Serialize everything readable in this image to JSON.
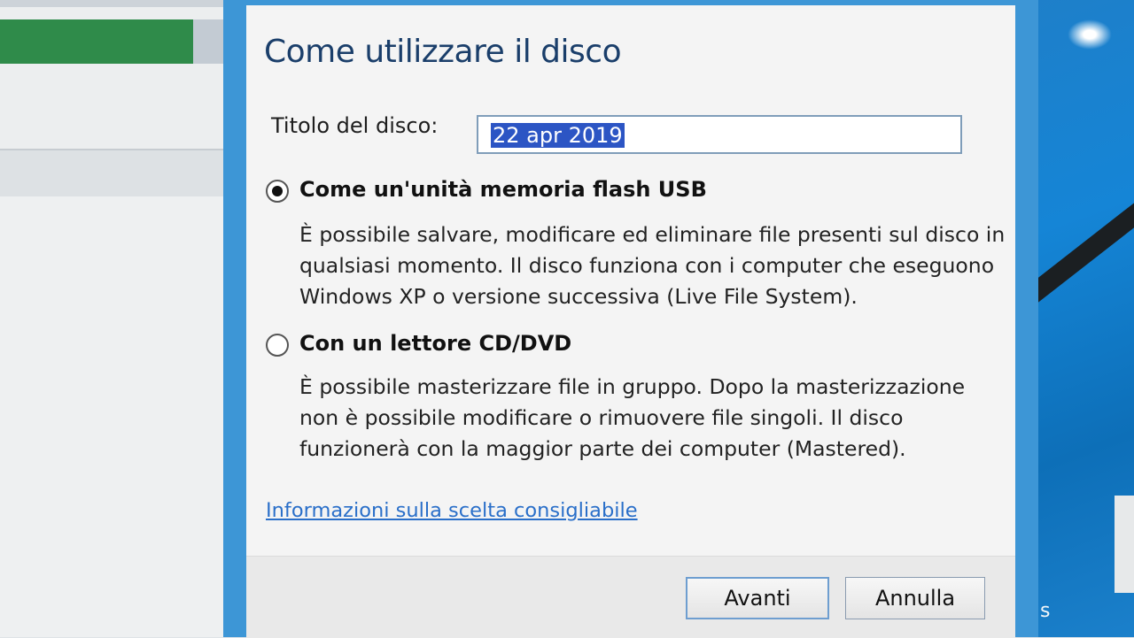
{
  "dialog": {
    "title": "Come utilizzare il disco",
    "disc_title_label": "Titolo del disco:",
    "disc_title_value": "22 apr 2019",
    "options": [
      {
        "label": "Come un'unità memoria flash USB",
        "selected": true,
        "description": "È possibile salvare, modificare ed eliminare file presenti sul disco in qualsiasi momento. Il disco funziona con i computer che eseguono Windows XP o versione successiva (Live File System)."
      },
      {
        "label": "Con un lettore CD/DVD",
        "selected": false,
        "description": "È possibile masterizzare file in gruppo. Dopo la masterizzazione non è possibile modificare o rimuovere file singoli. Il disco funzionerà con la maggior parte dei computer (Mastered)."
      }
    ],
    "help_link": "Informazioni sulla scelta consigliabile",
    "buttons": {
      "next": "Avanti",
      "cancel": "Annulla"
    }
  },
  "desktop": {
    "label_fragment": "ds"
  },
  "colors": {
    "title_text": "#1a3e6a",
    "selection": "#2c55c4",
    "link": "#2a6fc9",
    "frame": "#3d96d6",
    "progress": "#2f8b4a"
  }
}
